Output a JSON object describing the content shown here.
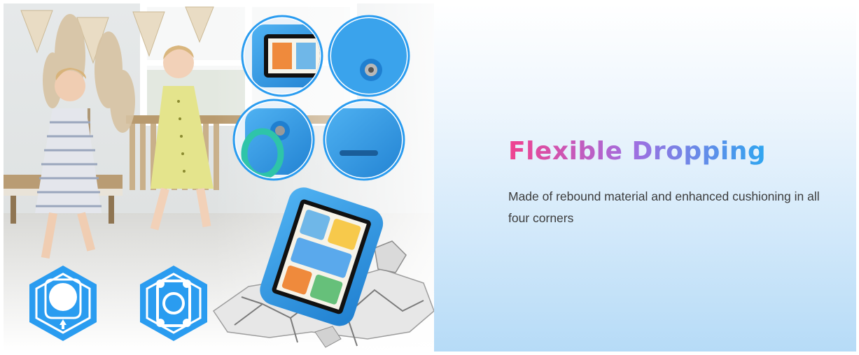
{
  "headline": {
    "text": "Flexible Dropping",
    "gradient_colors": [
      "#f0428f",
      "#a16ee0",
      "#2fa6f0"
    ]
  },
  "description": {
    "text": "Made of rebound material and enhanced cushioning in all four corners"
  },
  "colors": {
    "case_blue": "#3aa3ec",
    "case_dark_blue": "#1f7fd0",
    "ring_teal": "#2ec4a9",
    "badge_blue": "#2a9cf0",
    "panel_gradient_bottom": "#b6dbf7"
  },
  "images": {
    "scene": "children-walking-living-room",
    "detail_insets": [
      "tablet-case-corner",
      "tablet-case-ring-back",
      "ring-handle-detail",
      "case-corner-closeup"
    ],
    "hero_product": "kids-tablet-in-blue-case-breaking-floor",
    "badges": [
      "corner-cushion-hexagon-icon",
      "four-corner-protection-hexagon-icon"
    ]
  }
}
